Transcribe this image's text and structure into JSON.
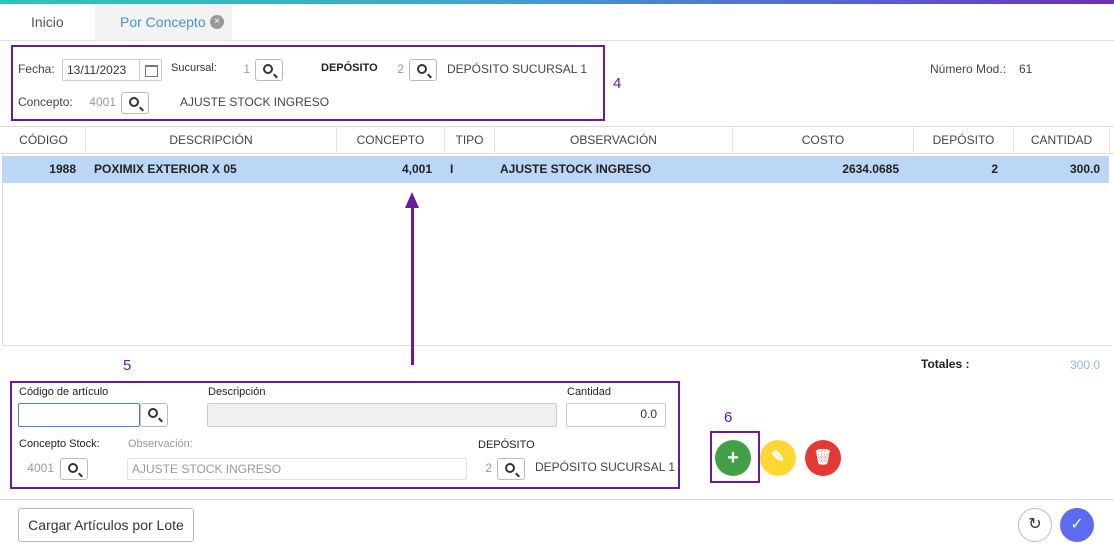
{
  "tabs": [
    {
      "label": "Inicio"
    },
    {
      "label": "Por Concepto",
      "close": "⊗"
    }
  ],
  "header": {
    "fecha_label": "Fecha:",
    "fecha_value": "13/11/2023",
    "sucursal_label": "Sucursal:",
    "sucursal_value": "1",
    "deposito_label": "DEPÓSITO",
    "deposito_value": "2",
    "deposito_name": "DEPÓSITO SUCURSAL 1",
    "numero_label": "Número Mod.:",
    "numero_value": "61",
    "concepto_label": "Concepto:",
    "concepto_value": "4001",
    "concepto_name": "AJUSTE STOCK INGRESO"
  },
  "annotations": {
    "a4": "4",
    "a5": "5",
    "a6": "6"
  },
  "grid": {
    "columns": [
      "CÓDIGO",
      "DESCRIPCIÓN",
      "CONCEPTO",
      "TIPO",
      "OBSERVACIÓN",
      "COSTO",
      "DEPÓSITO",
      "CANTIDAD"
    ],
    "rows": [
      {
        "codigo": "1988",
        "descripcion": "POXIMIX EXTERIOR X 05",
        "concepto": "4,001",
        "tipo": "I",
        "observacion": "AJUSTE STOCK INGRESO",
        "costo": "2634.0685",
        "deposito": "2",
        "cantidad": "300.0"
      }
    ]
  },
  "totales": {
    "label": "Totales :",
    "value": "300.0"
  },
  "form": {
    "codigo_label": "Código de artículo",
    "codigo_value": "",
    "descripcion_label": "Descripción",
    "descripcion_value": "",
    "cantidad_label": "Cantidad",
    "cantidad_value": "0.0",
    "concepto_stock_label": "Concepto Stock:",
    "concepto_stock_value": "4001",
    "observacion_label": "Observación:",
    "observacion_value": "AJUSTE STOCK INGRESO",
    "deposito_label": "DEPÓSITO",
    "deposito_value": "2",
    "deposito_name": "DEPÓSITO SUCURSAL 1"
  },
  "actions": {
    "add": "+",
    "edit": "✎",
    "delete": "🗑"
  },
  "footer": {
    "lote_button": "Cargar Artículos por Lote",
    "refresh": "↻",
    "confirm": "✓"
  },
  "colors": {
    "add": "#43a047",
    "edit": "#fdd835",
    "delete": "#e53935",
    "confirm": "#5c6bf0",
    "annotation": "#6a1b9a",
    "row_selected": "#bcd6f6"
  }
}
